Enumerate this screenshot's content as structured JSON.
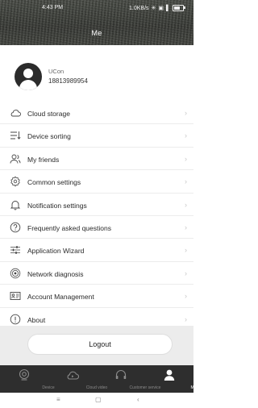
{
  "status_bar": {
    "time": "4:43 PM",
    "network_speed": "1.0KB/s"
  },
  "header": {
    "title": "Me"
  },
  "profile": {
    "name": "UCon",
    "phone": "18813989954"
  },
  "menu": [
    {
      "label": "Cloud storage",
      "icon": "cloud-icon"
    },
    {
      "label": "Device sorting",
      "icon": "sort-icon"
    },
    {
      "label": "My friends",
      "icon": "friends-icon"
    },
    {
      "label": "Common settings",
      "icon": "gear-icon"
    },
    {
      "label": "Notification settings",
      "icon": "bell-icon"
    },
    {
      "label": "Frequently asked questions",
      "icon": "question-icon"
    },
    {
      "label": "Application Wizard",
      "icon": "sliders-icon"
    },
    {
      "label": "Network diagnosis",
      "icon": "network-icon"
    },
    {
      "label": "Account Management",
      "icon": "account-card-icon"
    },
    {
      "label": "About",
      "icon": "info-icon"
    }
  ],
  "logout_label": "Logout",
  "tabs": [
    {
      "label": "Device",
      "active": false
    },
    {
      "label": "Cloud video",
      "active": false
    },
    {
      "label": "Customer service",
      "active": false
    },
    {
      "label": "Me",
      "active": true
    }
  ],
  "colors": {
    "tabbar_bg": "#2e2e2e",
    "tab_active": "#ffffff",
    "tab_inactive": "#8a8a8a"
  }
}
